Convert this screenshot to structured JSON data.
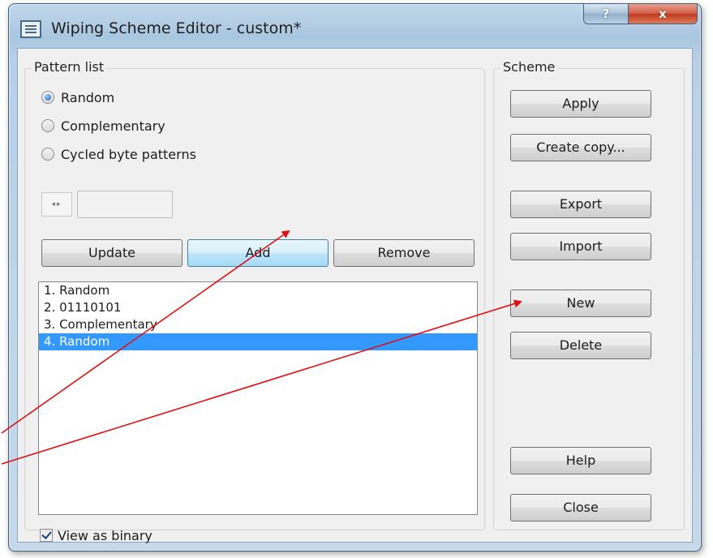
{
  "window": {
    "title": "Wiping Scheme Editor - custom*",
    "help_glyph": "?",
    "close_glyph": "x"
  },
  "pattern_list": {
    "label": "Pattern list",
    "options": [
      {
        "label": "Random",
        "selected": true
      },
      {
        "label": "Complementary",
        "selected": false
      },
      {
        "label": "Cycled byte patterns",
        "selected": false
      }
    ],
    "spinner_glyph": "◂▸",
    "buttons": {
      "update": "Update",
      "add": "Add",
      "remove": "Remove"
    },
    "items": [
      "1. Random",
      "2. 01110101",
      "3. Complementary",
      "4. Random"
    ],
    "selected_index": 3,
    "view_as_binary": {
      "label": "View as binary",
      "checked": true
    }
  },
  "scheme": {
    "label": "Scheme",
    "buttons": {
      "apply": "Apply",
      "create_copy": "Create copy...",
      "export": "Export",
      "import": "Import",
      "new": "New",
      "delete": "Delete",
      "help": "Help",
      "close": "Close"
    }
  },
  "annotation": {
    "arrow_color": "#e01010"
  }
}
